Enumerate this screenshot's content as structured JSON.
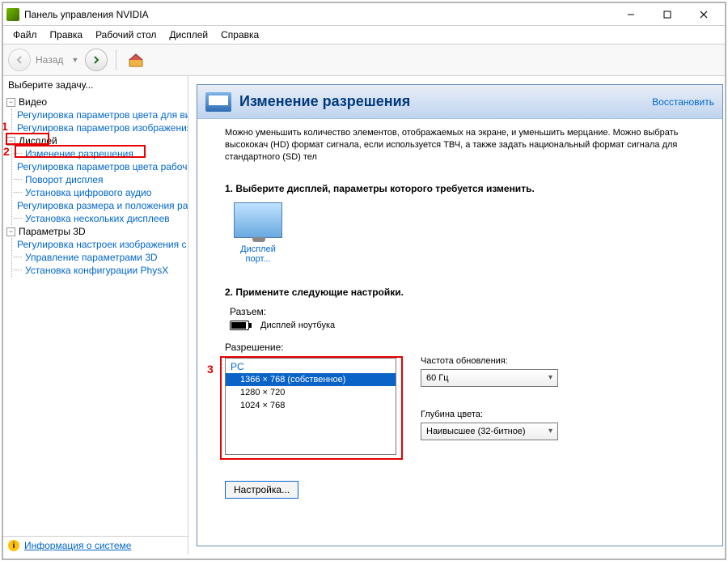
{
  "window": {
    "title": "Панель управления NVIDIA"
  },
  "menu": {
    "file": "Файл",
    "edit": "Правка",
    "desktop": "Рабочий стол",
    "display": "Дисплей",
    "help": "Справка"
  },
  "nav": {
    "back_label": "Назад"
  },
  "sidebar": {
    "header": "Выберите задачу...",
    "video": {
      "label": "Видео",
      "items": [
        "Регулировка параметров цвета для вид",
        "Регулировка параметров изображения д"
      ]
    },
    "display": {
      "label": "Дисплей",
      "items": [
        "Изменение разрешения",
        "Регулировка параметров цвета рабочег",
        "Поворот дисплея",
        "Установка цифрового аудио",
        "Регулировка размера и положения рабо",
        "Установка нескольких дисплеев"
      ]
    },
    "params3d": {
      "label": "Параметры 3D",
      "items": [
        "Регулировка настроек изображения с пр",
        "Управление параметрами 3D",
        "Установка конфигурации PhysX"
      ]
    },
    "footer_link": "Информация о системе"
  },
  "panel": {
    "title": "Изменение разрешения",
    "restore": "Восстановить",
    "intro": "Можно уменьшить количество элементов, отображаемых на экране, и уменьшить мерцание. Можно выбрать высококач (HD) формат сигнала, если используется ТВЧ, а также задать национальный формат сигнала для стандартного (SD) тел",
    "step1_title": "1. Выберите дисплей, параметры которого требуется изменить.",
    "display_name": "Дисплей порт...",
    "step2_title": "2. Примените следующие настройки.",
    "connector_label": "Разъем:",
    "connector_value": "Дисплей ноутбука",
    "resolution_label": "Разрешение:",
    "listbox_group": "PC",
    "resolutions": [
      "1366 × 768 (собственное)",
      "1280 × 720",
      "1024 × 768"
    ],
    "refresh_label": "Частота обновления:",
    "refresh_value": "60 Гц",
    "depth_label": "Глубина цвета:",
    "depth_value": "Наивысшее (32-битное)",
    "config_btn": "Настройка..."
  },
  "callouts": {
    "n1": "1",
    "n2": "2",
    "n3": "3"
  }
}
